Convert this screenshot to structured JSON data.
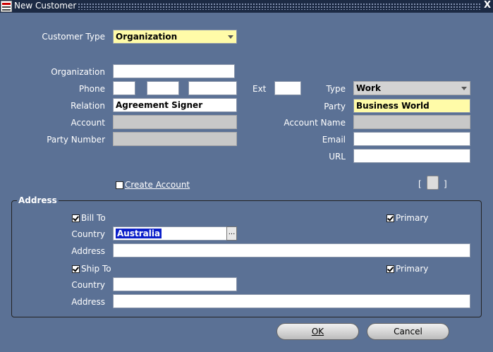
{
  "window": {
    "title": "New Customer",
    "close_label": "X"
  },
  "customer_type": {
    "label": "Customer Type",
    "value": "Organization"
  },
  "organization": {
    "label": "Organization",
    "value": ""
  },
  "phone": {
    "label": "Phone",
    "ext_label": "Ext"
  },
  "type": {
    "label": "Type",
    "value": "Work"
  },
  "relation": {
    "label": "Relation",
    "value": "Agreement Signer"
  },
  "party": {
    "label": "Party",
    "value": "Business World"
  },
  "account": {
    "label": "Account"
  },
  "account_name": {
    "label": "Account Name"
  },
  "party_number": {
    "label": "Party Number"
  },
  "email": {
    "label": "Email"
  },
  "url": {
    "label": "URL"
  },
  "create_account": {
    "label": "Create Account",
    "checked": false
  },
  "address_group": {
    "title": "Address",
    "bill_to": {
      "label": "Bill To",
      "checked": true,
      "primary_label": "Primary",
      "primary_checked": true,
      "country_label": "Country",
      "country_value": "Australia",
      "address_label": "Address",
      "lov_label": "..."
    },
    "ship_to": {
      "label": "Ship To",
      "checked": true,
      "primary_label": "Primary",
      "primary_checked": true,
      "country_label": "Country",
      "country_value": "",
      "address_label": "Address"
    }
  },
  "buttons": {
    "ok": "OK",
    "cancel": "Cancel"
  },
  "brackets": {
    "left": "[",
    "right": "]"
  }
}
